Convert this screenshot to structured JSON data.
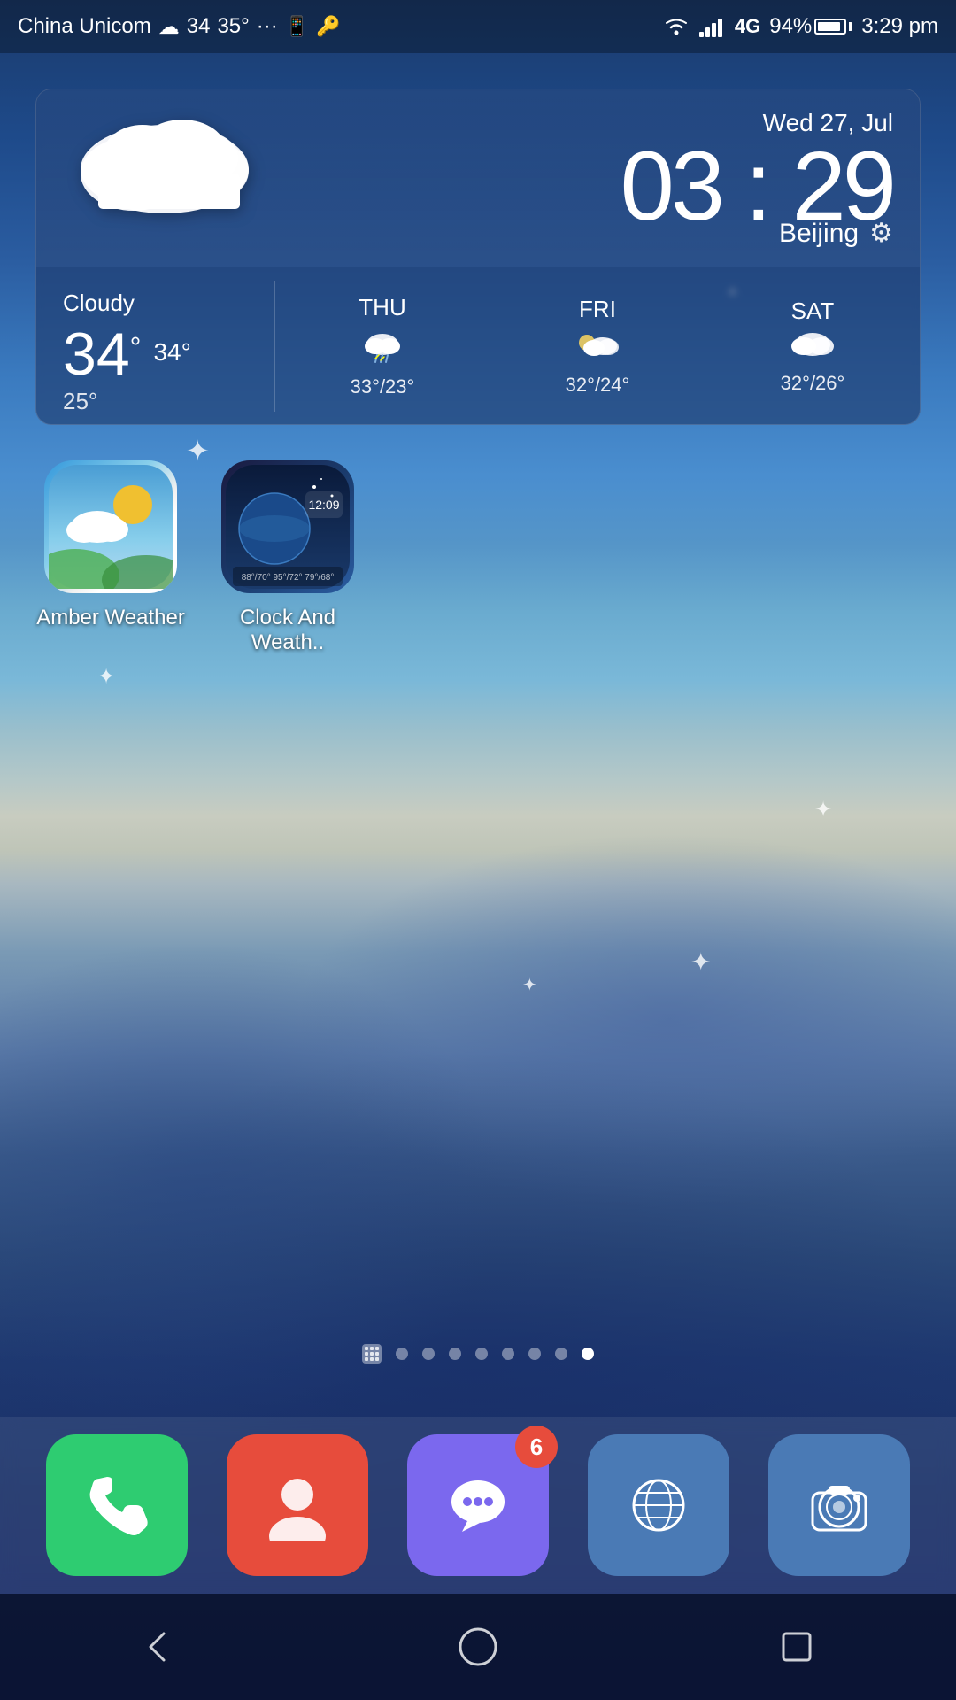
{
  "statusBar": {
    "carrier": "China Unicom",
    "weatherIcon": "☁",
    "temp": "34",
    "highTemp": "35°",
    "dots": "···",
    "battery": "94%",
    "time": "3:29 pm",
    "generation": "4G"
  },
  "weatherWidget": {
    "date": "Wed 27, Jul",
    "time": "03 : 29",
    "city": "Beijing",
    "condition": "Cloudy",
    "currentTemp": "34",
    "highTemp": "34°",
    "lowTemp": "25°",
    "forecast": [
      {
        "day": "THU",
        "icon": "⛈",
        "temps": "33°/23°"
      },
      {
        "day": "FRI",
        "icon": "⛅",
        "temps": "32°/24°"
      },
      {
        "day": "SAT",
        "icon": "☁",
        "temps": "32°/26°"
      }
    ]
  },
  "apps": [
    {
      "name": "Amber Weather",
      "id": "amber-weather"
    },
    {
      "name": "Clock And Weath..",
      "id": "clock-weather"
    }
  ],
  "pageIndicators": {
    "total": 8,
    "active": 8
  },
  "dock": [
    {
      "name": "Phone",
      "id": "phone",
      "badge": null
    },
    {
      "name": "Contacts",
      "id": "contacts",
      "badge": null
    },
    {
      "name": "Messages",
      "id": "messages",
      "badge": "6"
    },
    {
      "name": "Browser",
      "id": "browser",
      "badge": null
    },
    {
      "name": "Camera",
      "id": "camera",
      "badge": null
    }
  ],
  "navBar": {
    "back": "◁",
    "home": "○",
    "recent": "□"
  }
}
